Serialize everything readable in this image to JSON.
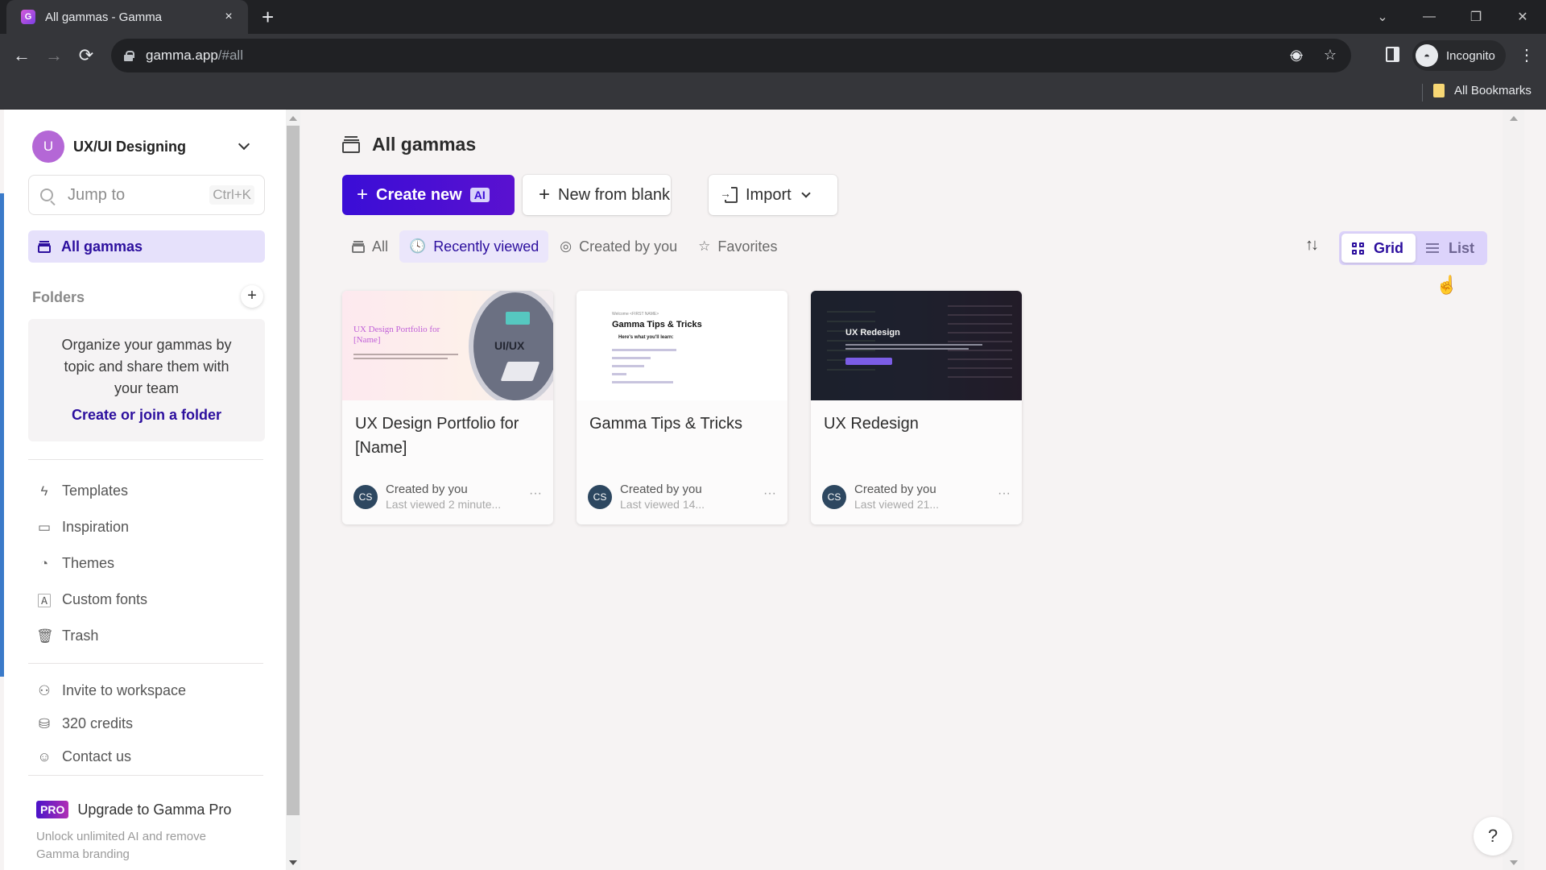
{
  "browser": {
    "tab_title": "All gammas - Gamma",
    "tab_favicon": "gamma-logo-icon",
    "url_host": "gamma.app",
    "url_path": "/#all",
    "profile_label": "Incognito",
    "bookmarks_label": "All Bookmarks",
    "icons": {
      "back": "←",
      "forward": "→",
      "reload": "⟳",
      "new_tab": "+",
      "close_tab": "×",
      "eye_off": "👁",
      "star": "☆",
      "kebab": "⋮",
      "min": "—",
      "restore": "❐",
      "close": "✕",
      "tab_search": "⌄"
    }
  },
  "sidebar": {
    "workspace": {
      "avatar_letter": "U",
      "name": "UX/UI Designing",
      "avatar_color": "#b467d6"
    },
    "search": {
      "placeholder": "Jump to",
      "shortcut": "Ctrl+K"
    },
    "active_item": "All gammas",
    "folders": {
      "heading": "Folders",
      "add_icon": "+",
      "empty_text": "Organize your gammas by topic and share them with your team",
      "link": "Create or join a folder"
    },
    "items": [
      {
        "label": "Templates",
        "icon": "⚡"
      },
      {
        "label": "Inspiration",
        "icon": "📖"
      },
      {
        "label": "Themes",
        "icon": "🎨"
      },
      {
        "label": "Custom fonts",
        "icon": "🅰"
      },
      {
        "label": "Trash",
        "icon": "🗑"
      }
    ],
    "secondary_items": [
      {
        "label": "Invite to workspace",
        "icon": "👤+"
      },
      {
        "label": "320 credits",
        "icon": "🪙"
      },
      {
        "label": "Contact us",
        "icon": "💬"
      }
    ],
    "upgrade": {
      "badge": "PRO",
      "label": "Upgrade to Gamma Pro",
      "subtitle": "Unlock unlimited AI and remove Gamma branding"
    }
  },
  "main": {
    "title": "All gammas",
    "buttons": {
      "create_new": "Create new",
      "ai_badge": "AI",
      "new_from_blank": "New from blank",
      "import": "Import"
    },
    "filters": [
      {
        "label": "All",
        "active": false
      },
      {
        "label": "Recently viewed",
        "active": true
      },
      {
        "label": "Created by you",
        "active": false
      },
      {
        "label": "Favorites",
        "active": false
      }
    ],
    "view": {
      "grid_label": "Grid",
      "list_label": "List",
      "selected": "Grid"
    },
    "sort_icon": "↑↓",
    "cards": [
      {
        "title": "UX Design Portfolio for [Name]",
        "thumb_title": "UX Design Portfolio for [Name]",
        "thumb_badge": "UI/UX",
        "avatar": "CS",
        "created_by": "Created by you",
        "last_viewed": "Last viewed 2 minute..."
      },
      {
        "title": "Gamma Tips & Tricks",
        "thumb_small": "Welcome <FIRST NAME>",
        "thumb_title": "Gamma Tips & Tricks",
        "thumb_sub": "Here's what you'll learn:",
        "avatar": "CS",
        "created_by": "Created by you",
        "last_viewed": "Last viewed 14..."
      },
      {
        "title": "UX Redesign",
        "thumb_title": "UX Redesign",
        "avatar": "CS",
        "created_by": "Created by you",
        "last_viewed": "Last viewed 21..."
      }
    ],
    "more_icon": "···",
    "help_icon": "?"
  },
  "colors": {
    "brand_primary": "#3a0dd6",
    "active_nav_bg": "#e6e1fb",
    "active_text": "#2c0f9e",
    "avatar_cs": "#2d4760"
  }
}
